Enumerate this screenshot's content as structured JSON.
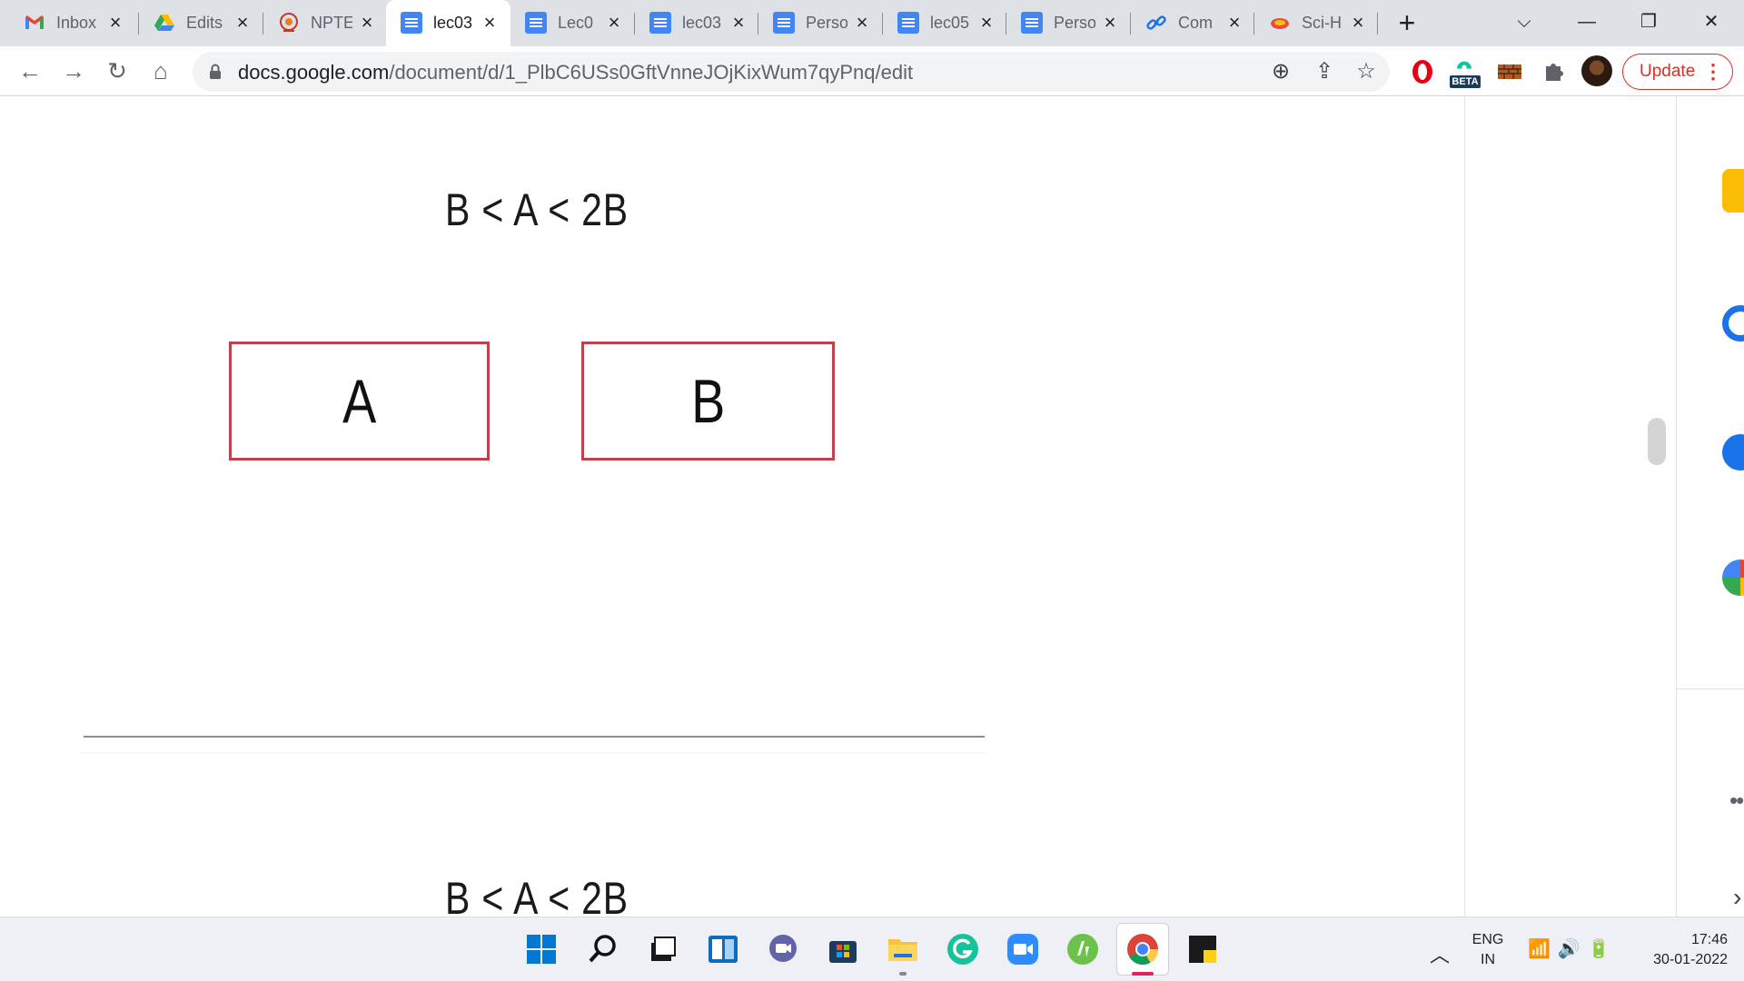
{
  "browser": {
    "tabs": [
      {
        "title": "Inbox",
        "icon": "gmail-icon",
        "active": false
      },
      {
        "title": "Edits",
        "icon": "google-drive-icon",
        "active": false
      },
      {
        "title": "NPTE",
        "icon": "nptel-icon",
        "active": false
      },
      {
        "title": "lec03",
        "icon": "google-docs-icon",
        "active": true
      },
      {
        "title": "Lec0",
        "icon": "google-docs-icon",
        "active": false
      },
      {
        "title": "lec03",
        "icon": "google-docs-icon",
        "active": false
      },
      {
        "title": "Perso",
        "icon": "google-docs-icon",
        "active": false
      },
      {
        "title": "lec05",
        "icon": "google-docs-icon",
        "active": false
      },
      {
        "title": "Perso",
        "icon": "google-docs-icon",
        "active": false
      },
      {
        "title": "Com",
        "icon": "link-icon",
        "active": false
      },
      {
        "title": "Sci-H",
        "icon": "sci-hub-icon",
        "active": false
      }
    ],
    "new_tab": "+",
    "url_host": "docs.google.com",
    "url_path": "/document/d/1_PlbC6USs0GftVnneJOjKixWum7qyPnq/edit",
    "update_label": "Update",
    "beta_badge": "BETA"
  },
  "document": {
    "inequality_top": "B < A < 2B",
    "box_a": "A",
    "box_b": "B",
    "inequality_bottom": "B < A < 2B"
  },
  "taskbar": {
    "lang_line1": "ENG",
    "lang_line2": "IN",
    "time": "17:46",
    "date": "30-01-2022"
  },
  "colors": {
    "box_border": "#c0404c",
    "update_red": "#d93025",
    "docs_blue": "#4285f4"
  }
}
